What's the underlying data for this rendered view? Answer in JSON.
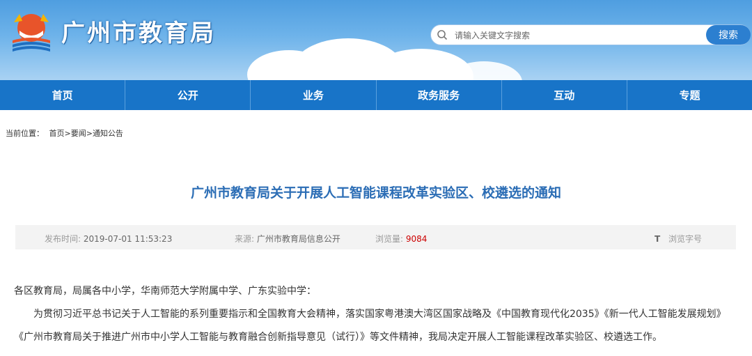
{
  "header": {
    "site_name": "广州市教育局",
    "search_placeholder": "请输入关键文字搜索",
    "search_button": "搜索"
  },
  "nav": {
    "items": [
      {
        "label": "首页"
      },
      {
        "label": "公开"
      },
      {
        "label": "业务"
      },
      {
        "label": "政务服务"
      },
      {
        "label": "互动"
      },
      {
        "label": "专题"
      }
    ]
  },
  "breadcrumb": {
    "prefix": "当前位置：",
    "home": "首页",
    "sep1": ">",
    "news": "要闻",
    "sep2": ">",
    "current": "通知公告"
  },
  "article": {
    "title": "广州市教育局关于开展人工智能课程改革实验区、校遴选的通知",
    "publish_label": "发布时间:",
    "publish_time": "2019-07-01 11:53:23",
    "source_label": "来源:",
    "source": "广州市教育局信息公开",
    "views_label": "浏览量:",
    "views": "9084",
    "font_icon": "T",
    "font_size_label": "浏览字号",
    "salutation": "各区教育局，局属各中小学，华南师范大学附属中学、广东实验中学：",
    "paragraph1": "为贯彻习近平总书记关于人工智能的系列重要指示和全国教育大会精神，落实国家粤港澳大湾区国家战略及《中国教育现代化2035》《新一代人工智能发展规划》《广州市教育局关于推进广州市中小学人工智能与教育融合创新指导意见（试行）》等文件精神，我局决定开展人工智能课程改革实验区、校遴选工作。"
  },
  "colors": {
    "nav_bg": "#1874c8",
    "title": "#2b6db5",
    "search_button": "#2c7fd0",
    "view_count": "#cc0000"
  }
}
